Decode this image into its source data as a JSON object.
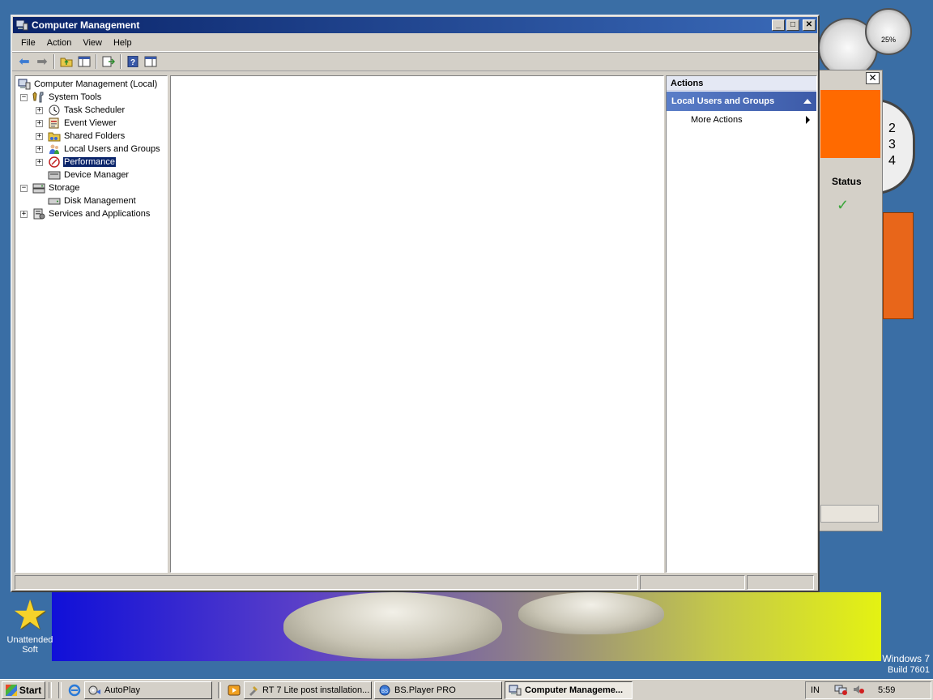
{
  "window": {
    "title": "Computer Management",
    "minimize_glyph": "_",
    "maximize_glyph": "□",
    "close_glyph": "✕"
  },
  "menu": [
    "File",
    "Action",
    "View",
    "Help"
  ],
  "toolbar": {
    "icons": [
      "back-arrow-icon",
      "forward-arrow-icon",
      "up-folder-icon",
      "show-hide-console-tree-icon",
      "export-list-icon",
      "help-icon",
      "show-hide-action-pane-icon"
    ]
  },
  "tree": {
    "root": "Computer Management (Local)",
    "system_tools": "System Tools",
    "task_scheduler": "Task Scheduler",
    "event_viewer": "Event Viewer",
    "shared_folders": "Shared Folders",
    "local_users": "Local Users and Groups",
    "performance": "Performance",
    "device_manager": "Device Manager",
    "storage": "Storage",
    "disk_management": "Disk Management",
    "services": "Services and Applications",
    "expand_glyph": "+",
    "collapse_glyph": "−"
  },
  "actions": {
    "header": "Actions",
    "section": "Local Users and Groups",
    "more_actions": "More Actions"
  },
  "background_gadget": {
    "status_label": "Status",
    "cpu_label": "25%",
    "clock_digits": [
      "2",
      "3",
      "4"
    ]
  },
  "desktop": {
    "icon_label_line1": "Unattended",
    "icon_label_line2": "Soft",
    "brand_line1": "Windows 7",
    "brand_line2": "Build 7601"
  },
  "taskbar": {
    "start": "Start",
    "buttons": [
      "AutoPlay",
      "RT 7 Lite post installation...",
      "BS.Player PRO",
      "Computer Manageme..."
    ],
    "tray_lang": "IN",
    "time": "5:59"
  },
  "colors": {
    "titlebar_start": "#0a246a",
    "titlebar_end": "#3a6ab8",
    "selection": "#0a246a",
    "actions_section": "#4a6cb8",
    "desktop": "#3a6ea5"
  }
}
